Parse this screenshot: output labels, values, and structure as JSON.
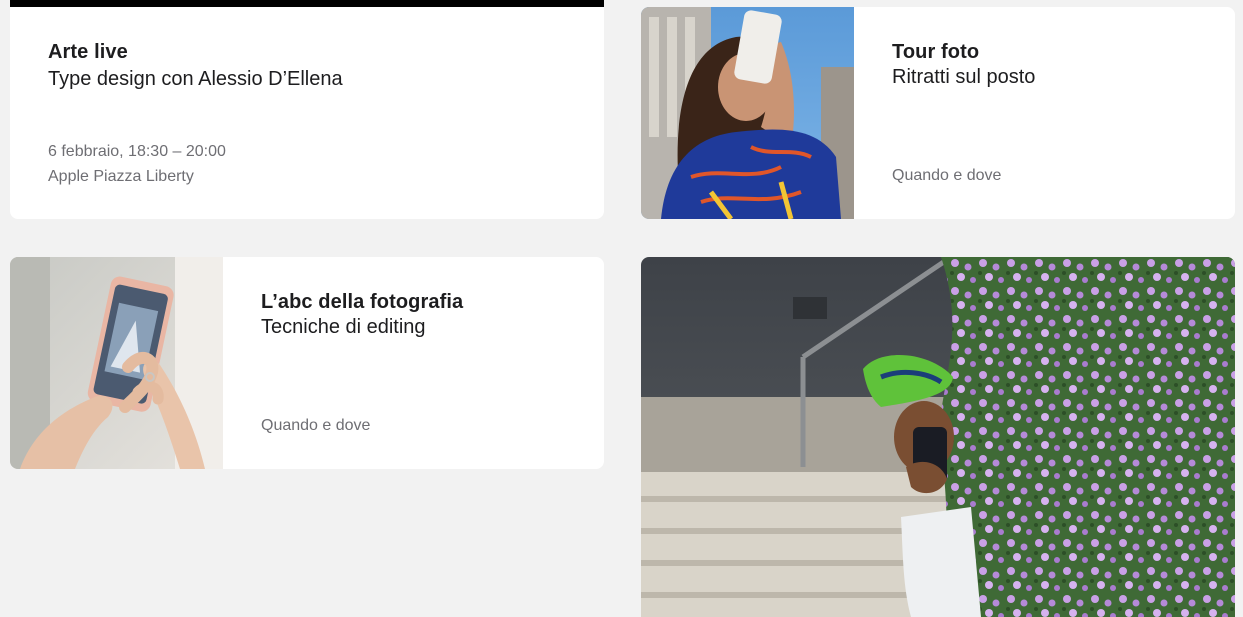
{
  "cards": [
    {
      "eyebrow": "Arte live",
      "title": "Type design con Alessio D’Ellena",
      "date": "6 febbraio, 18:30 – 20:00",
      "location": "Apple Piazza Liberty"
    },
    {
      "eyebrow": "Tour foto",
      "title": "Ritratti sul posto",
      "link": "Quando e dove"
    },
    {
      "eyebrow": "L’abc della fotografia",
      "title": "Tecniche di editing",
      "link": "Quando e dove"
    }
  ],
  "colors": {
    "page_bg": "#f2f2f2",
    "card_bg": "#ffffff",
    "text_primary": "#1d1d1f",
    "text_secondary": "#6e6e73"
  }
}
